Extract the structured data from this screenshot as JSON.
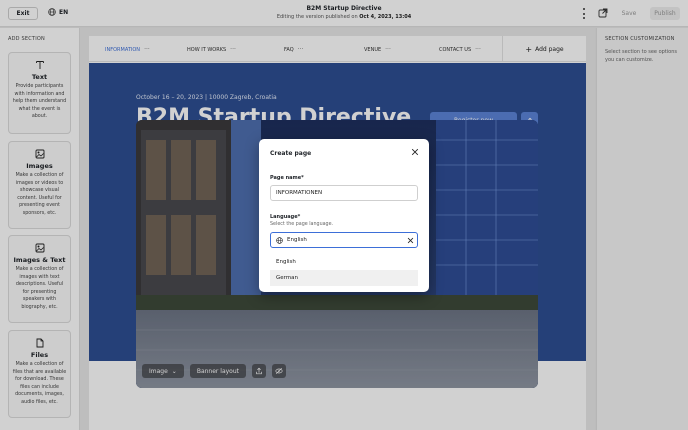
{
  "topbar": {
    "exit_label": "Exit",
    "language": "EN",
    "title": "B2M Startup Directive",
    "subtitle_prefix": "Editing the version published on",
    "subtitle_date": "Oct 4, 2023, 13:04",
    "save_label": "Save",
    "publish_label": "Publish"
  },
  "left_panel": {
    "heading": "ADD SECTION",
    "cards": [
      {
        "title": "Text",
        "icon": "text-icon",
        "desc": "Provide participants with information and help them understand what the event is about."
      },
      {
        "title": "Images",
        "icon": "image-icon",
        "desc": "Make a collection of images or videos to showcase visual content. Useful for presenting event sponsors, etc."
      },
      {
        "title": "Images & Text",
        "icon": "image-text-icon",
        "desc": "Make a collection of images with text descriptions. Useful for presenting speakers with biography, etc."
      },
      {
        "title": "Files",
        "icon": "file-icon",
        "desc": "Make a collection of files that are available for download. These files can include documents, images, audio files, etc."
      }
    ]
  },
  "nav": {
    "items": [
      {
        "label": "INFORMATION"
      },
      {
        "label": "HOW IT WORKS"
      },
      {
        "label": "FAQ"
      },
      {
        "label": "VENUE"
      },
      {
        "label": "CONTACT US"
      }
    ],
    "add_page_label": "Add page"
  },
  "hero": {
    "date_line": "October 16 – 20, 2023  |  10000 Zagreb, Croatia",
    "title": "B2M Startup Directive",
    "register_label": "Register now"
  },
  "photo_toolbar": {
    "image_label": "Image",
    "banner_label": "Banner layout"
  },
  "right_panel": {
    "heading": "SECTION CUSTOMIZATION",
    "desc": "Select section to see options you can customize."
  },
  "modal": {
    "title": "Create page",
    "page_name_label": "Page name*",
    "page_name_value": "INFORMATIONEN",
    "language_label": "Language*",
    "language_hint": "Select the page language.",
    "language_value": "English",
    "options": [
      "English",
      "German"
    ]
  },
  "colors": {
    "accent": "#3d6fd8",
    "hero_bg": "#2e4f93",
    "register_btn": "#5c84d8"
  }
}
